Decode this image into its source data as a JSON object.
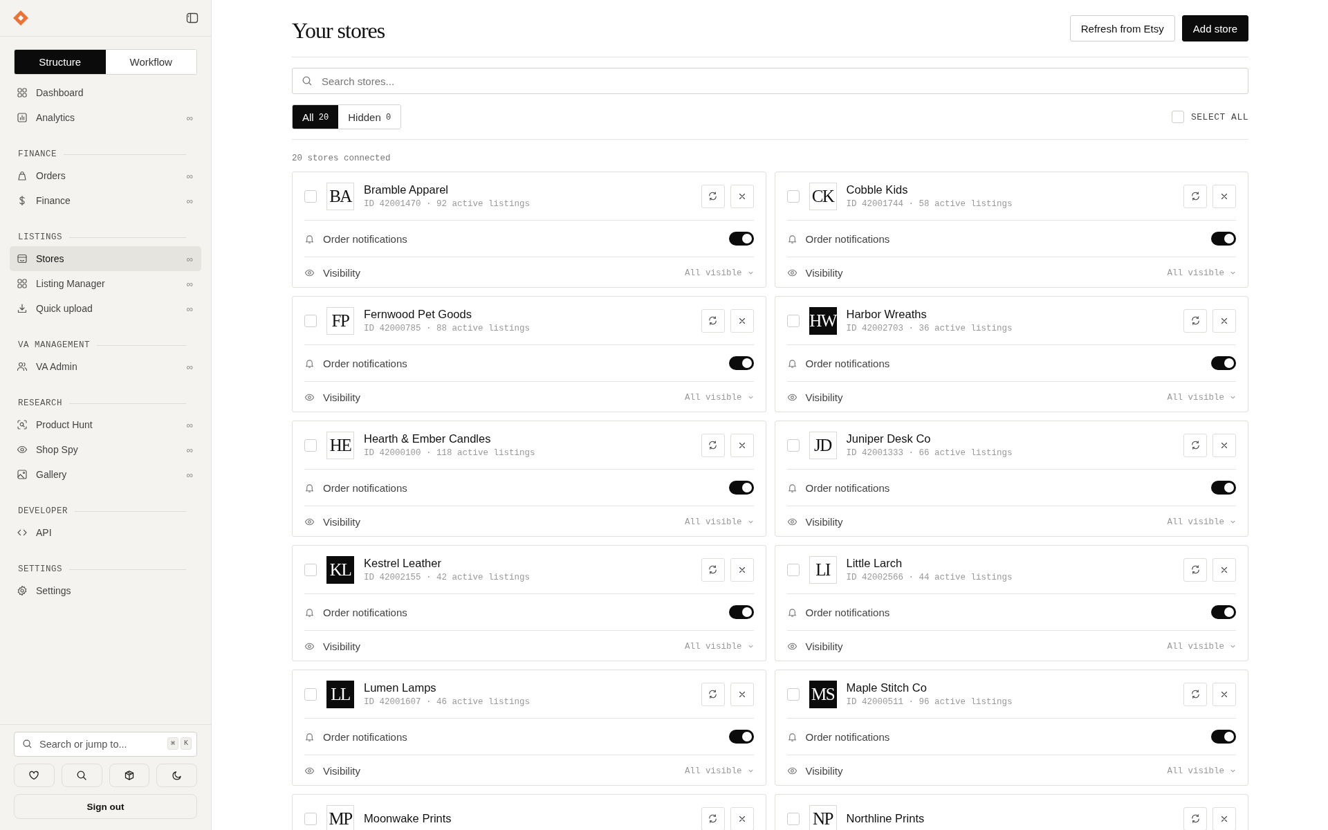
{
  "sidebar": {
    "modes": [
      {
        "label": "Structure",
        "selected": true
      },
      {
        "label": "Workflow",
        "selected": false
      }
    ],
    "sections": [
      {
        "items": [
          {
            "label": "Dashboard",
            "selected": false
          },
          {
            "label": "Analytics",
            "badge": "∞",
            "selected": false
          }
        ]
      },
      {
        "heading": "FINANCE",
        "items": [
          {
            "label": "Orders",
            "badge": "∞",
            "selected": false
          },
          {
            "label": "Finance",
            "badge": "∞",
            "selected": false
          }
        ]
      },
      {
        "heading": "LISTINGS",
        "items": [
          {
            "label": "Stores",
            "badge": "∞",
            "selected": true
          },
          {
            "label": "Listing Manager",
            "badge": "∞",
            "selected": false
          },
          {
            "label": "Quick upload",
            "badge": "∞",
            "selected": false
          }
        ]
      },
      {
        "heading": "VA MANAGEMENT",
        "items": [
          {
            "label": "VA Admin",
            "badge": "∞",
            "selected": false
          }
        ]
      },
      {
        "heading": "RESEARCH",
        "items": [
          {
            "label": "Product Hunt",
            "badge": "∞",
            "selected": false
          },
          {
            "label": "Shop Spy",
            "badge": "∞",
            "selected": false
          },
          {
            "label": "Gallery",
            "badge": "∞",
            "selected": false
          }
        ]
      },
      {
        "heading": "DEVELOPER",
        "items": [
          {
            "label": "API",
            "selected": false
          }
        ]
      },
      {
        "heading": "SETTINGS",
        "items": [
          {
            "label": "Settings",
            "selected": false
          }
        ]
      }
    ],
    "search": {
      "placeholder": "Search or jump to...",
      "keys": [
        "⌘",
        "K"
      ]
    },
    "sign_out": "Sign out"
  },
  "main": {
    "title": "Your stores",
    "buttons": [
      {
        "label": "Refresh from Etsy",
        "kind": "secondary"
      },
      {
        "label": "Add store",
        "kind": "primary"
      }
    ],
    "search": {
      "placeholder": "Search stores..."
    },
    "filters": [
      {
        "label": "All",
        "count": "20",
        "selected": true
      },
      {
        "label": "Hidden",
        "count": "0",
        "selected": false
      }
    ],
    "select_all": {
      "label": "SELECT ALL",
      "checked": false
    },
    "summary": "20 stores connected",
    "stores": [
      {
        "initials": "BA",
        "name": "Bramble Apparel",
        "meta": "ID 42001470 · 92 active listings",
        "dark": false,
        "checked": false,
        "notifications": {
          "label": "Order notifications",
          "on": true
        },
        "visibility": {
          "label": "Visibility",
          "value": "All visible"
        }
      },
      {
        "initials": "CK",
        "name": "Cobble Kids",
        "meta": "ID 42001744 · 58 active listings",
        "dark": false,
        "checked": false,
        "notifications": {
          "label": "Order notifications",
          "on": true
        },
        "visibility": {
          "label": "Visibility",
          "value": "All visible"
        }
      },
      {
        "initials": "FP",
        "name": "Fernwood Pet Goods",
        "meta": "ID 42000785 · 88 active listings",
        "dark": false,
        "checked": false,
        "notifications": {
          "label": "Order notifications",
          "on": true
        },
        "visibility": {
          "label": "Visibility",
          "value": "All visible"
        }
      },
      {
        "initials": "HW",
        "name": "Harbor Wreaths",
        "meta": "ID 42002703 · 36 active listings",
        "dark": true,
        "checked": false,
        "notifications": {
          "label": "Order notifications",
          "on": true
        },
        "visibility": {
          "label": "Visibility",
          "value": "All visible"
        }
      },
      {
        "initials": "HE",
        "name": "Hearth & Ember Candles",
        "meta": "ID 42000100 · 118 active listings",
        "dark": false,
        "checked": false,
        "notifications": {
          "label": "Order notifications",
          "on": true
        },
        "visibility": {
          "label": "Visibility",
          "value": "All visible"
        }
      },
      {
        "initials": "JD",
        "name": "Juniper Desk Co",
        "meta": "ID 42001333 · 66 active listings",
        "dark": false,
        "checked": false,
        "notifications": {
          "label": "Order notifications",
          "on": true
        },
        "visibility": {
          "label": "Visibility",
          "value": "All visible"
        }
      },
      {
        "initials": "KL",
        "name": "Kestrel Leather",
        "meta": "ID 42002155 · 42 active listings",
        "dark": true,
        "checked": false,
        "notifications": {
          "label": "Order notifications",
          "on": true
        },
        "visibility": {
          "label": "Visibility",
          "value": "All visible"
        }
      },
      {
        "initials": "LI",
        "name": "Little Larch",
        "meta": "ID 42002566 · 44 active listings",
        "dark": false,
        "checked": false,
        "notifications": {
          "label": "Order notifications",
          "on": true
        },
        "visibility": {
          "label": "Visibility",
          "value": "All visible"
        }
      },
      {
        "initials": "LL",
        "name": "Lumen Lamps",
        "meta": "ID 42001607 · 46 active listings",
        "dark": true,
        "checked": false,
        "notifications": {
          "label": "Order notifications",
          "on": true
        },
        "visibility": {
          "label": "Visibility",
          "value": "All visible"
        }
      },
      {
        "initials": "MS",
        "name": "Maple Stitch Co",
        "meta": "ID 42000511 · 96 active listings",
        "dark": true,
        "checked": false,
        "notifications": {
          "label": "Order notifications",
          "on": true
        },
        "visibility": {
          "label": "Visibility",
          "value": "All visible"
        }
      },
      {
        "initials": "MP",
        "name": "Moonwake Prints",
        "dark": false,
        "checked": false
      },
      {
        "initials": "NP",
        "name": "Northline Prints",
        "dark": false,
        "checked": false
      }
    ]
  }
}
